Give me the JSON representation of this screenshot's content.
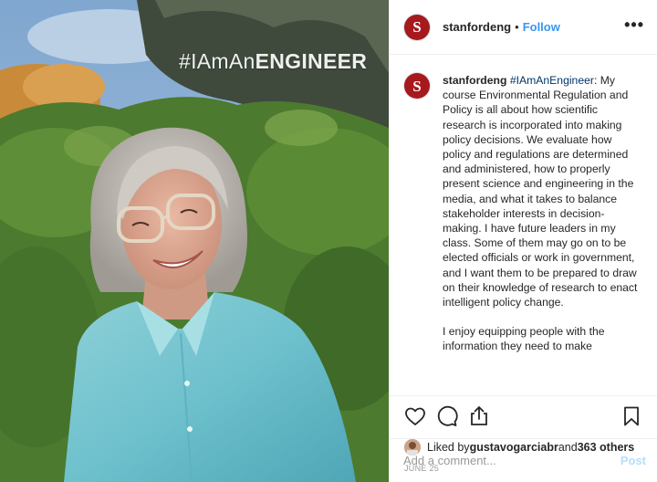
{
  "photo": {
    "overlay_prefix": "#IAmAn",
    "overlay_bold": "ENGINEER"
  },
  "header": {
    "avatar_letter": "S",
    "username": "stanfordeng",
    "separator": "•",
    "follow_label": "Follow",
    "more_label": "•••"
  },
  "caption": {
    "username": "stanfordeng",
    "hashtag": "#IAmAnEngineer",
    "paragraph1": ": My course Environmental Regulation and Policy is all about how scientific research is incorporated into making policy decisions. We evaluate how policy and regulations are determined and administered, how to properly present science and engineering in the media, and what it takes to balance stakeholder interests in decision-making. I have future leaders in my class. Some of them may go on to be elected officials or work in government, and I want them to be prepared to draw on their knowledge of research to enact intelligent policy change.",
    "paragraph2": "I enjoy equipping people with the information they need to make"
  },
  "actions": {
    "like_icon": "heart-icon",
    "comment_icon": "comment-icon",
    "share_icon": "share-icon",
    "save_icon": "bookmark-icon"
  },
  "likes": {
    "prefix": "Liked by ",
    "user": "gustavogarciabr",
    "middle": " and ",
    "count": "363 others"
  },
  "date": "JUNE 25",
  "add_comment": {
    "placeholder": "Add a comment...",
    "post_label": "Post"
  },
  "colors": {
    "brand": "#a6191d",
    "follow": "#3897f0",
    "hashtag": "#003569"
  }
}
